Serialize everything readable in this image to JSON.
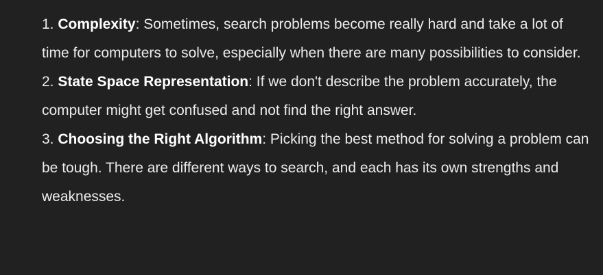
{
  "message": {
    "items": [
      {
        "number": "1.",
        "term": "Complexity",
        "separator": ":",
        "text": " Sometimes, search problems become really hard and take a lot of time for computers to solve, especially when there are many possibilities to consider."
      },
      {
        "number": "2.",
        "term": "State Space Representation",
        "separator": ":",
        "text": " If we don't describe the problem accurately, the computer might get confused and not find the right answer."
      },
      {
        "number": "3.",
        "term": "Choosing the Right Algorithm",
        "separator": ":",
        "text": " Picking the best method for solving a problem can be tough. There are different ways to search, and each has its own strengths and weaknesses."
      }
    ]
  },
  "colors": {
    "background": "#212121",
    "text": "#ececec",
    "emphasis": "#ffffff"
  }
}
